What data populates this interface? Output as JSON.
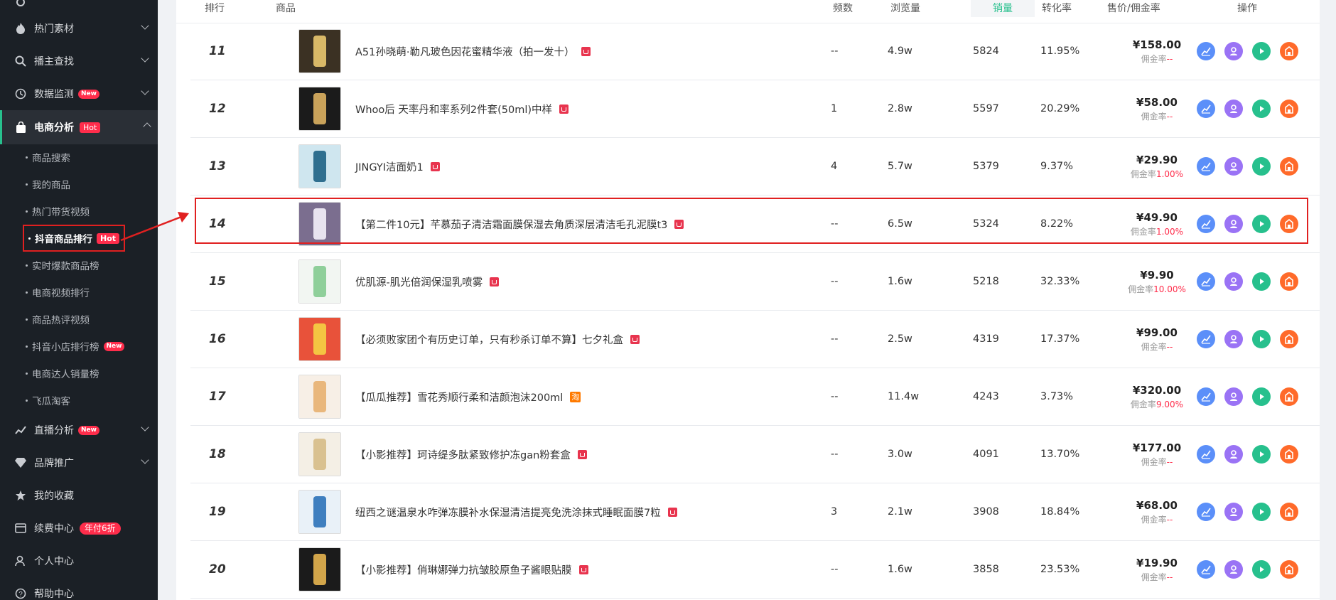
{
  "colors": {
    "accent": "#27c08d",
    "badge_red": "#ff2d4b",
    "highlight": "#e02020",
    "sidebar_bg": "#1b2026"
  },
  "sidebar": {
    "items": [
      {
        "label": "",
        "icon": "gear-icon",
        "chevron": true
      },
      {
        "label": "热门素材",
        "icon": "fire-icon",
        "chevron": true
      },
      {
        "label": "播主查找",
        "icon": "search-icon",
        "chevron": true
      },
      {
        "label": "数据监测",
        "icon": "monitor-icon",
        "chevron": true,
        "badge": "New"
      },
      {
        "label": "电商分析",
        "icon": "bag-icon",
        "chevron": true,
        "badge": "Hot",
        "active": true
      },
      {
        "label": "直播分析",
        "icon": "live-icon",
        "chevron": true,
        "badge": "New"
      },
      {
        "label": "品牌推广",
        "icon": "diamond-icon",
        "chevron": true
      },
      {
        "label": "我的收藏",
        "icon": "star-icon"
      },
      {
        "label": "续费中心",
        "icon": "card-icon",
        "badge": "年付6折"
      },
      {
        "label": "个人中心",
        "icon": "person-icon"
      },
      {
        "label": "帮助中心",
        "icon": "help-icon"
      }
    ],
    "sub_items": [
      {
        "label": "商品搜索"
      },
      {
        "label": "我的商品"
      },
      {
        "label": "热门带货视频"
      },
      {
        "label": "抖音商品排行",
        "badge": "Hot",
        "current": true
      },
      {
        "label": "实时爆款商品榜"
      },
      {
        "label": "电商视频排行"
      },
      {
        "label": "商品热评视频"
      },
      {
        "label": "抖音小店排行榜",
        "badge": "New"
      },
      {
        "label": "电商达人销量榜"
      },
      {
        "label": "飞瓜淘客"
      }
    ]
  },
  "table": {
    "headers": {
      "rank": "排行",
      "product": "商品",
      "freq": "频数",
      "views": "浏览量",
      "sales": "销量",
      "conv": "转化率",
      "price": "售价/佣金率",
      "ops": "操作"
    },
    "commission_label": "佣金率",
    "rows": [
      {
        "rank": "11",
        "name": "A51孙晓萌·勒凡玻色因花蜜精华液（拍一发十）",
        "tag": "shop",
        "freq": "--",
        "views": "4.9w",
        "sales": "5824",
        "conv": "11.95%",
        "price": "¥158.00",
        "rate": "--"
      },
      {
        "rank": "12",
        "name": "Whoo后 天率丹和率系列2件套(50ml)中样",
        "tag": "shop",
        "freq": "1",
        "views": "2.8w",
        "sales": "5597",
        "conv": "20.29%",
        "price": "¥58.00",
        "rate": "--"
      },
      {
        "rank": "13",
        "name": "JINGYI洁面奶1",
        "tag": "shop",
        "freq": "4",
        "views": "5.7w",
        "sales": "5379",
        "conv": "9.37%",
        "price": "¥29.90",
        "rate": "1.00%"
      },
      {
        "rank": "14",
        "name": "【第二件10元】芊慕茄子清洁霜面膜保湿去角质深层清洁毛孔泥膜t3",
        "tag": "shop",
        "freq": "--",
        "views": "6.5w",
        "sales": "5324",
        "conv": "8.22%",
        "price": "¥49.90",
        "rate": "1.00%"
      },
      {
        "rank": "15",
        "name": "优肌源-肌光倍润保湿乳喷雾",
        "tag": "shop",
        "freq": "--",
        "views": "1.6w",
        "sales": "5218",
        "conv": "32.33%",
        "price": "¥9.90",
        "rate": "10.00%"
      },
      {
        "rank": "16",
        "name": "【必须败家团个有历史订单，只有秒杀订单不算】七夕礼盒",
        "tag": "shop",
        "freq": "--",
        "views": "2.5w",
        "sales": "4319",
        "conv": "17.37%",
        "price": "¥99.00",
        "rate": "--"
      },
      {
        "rank": "17",
        "name": "【瓜瓜推荐】雪花秀顺行柔和洁颜泡沫200ml",
        "tag": "taobao",
        "tag_text": "淘",
        "freq": "--",
        "views": "11.4w",
        "sales": "4243",
        "conv": "3.73%",
        "price": "¥320.00",
        "rate": "9.00%"
      },
      {
        "rank": "18",
        "name": "【小影推荐】珂诗缇多肽紧致修护冻gan粉套盒",
        "tag": "shop",
        "freq": "--",
        "views": "3.0w",
        "sales": "4091",
        "conv": "13.70%",
        "price": "¥177.00",
        "rate": "--"
      },
      {
        "rank": "19",
        "name": "纽西之谜温泉水咋弹冻膜补水保湿清洁提亮免洗涂抹式睡眠面膜7粒",
        "tag": "shop",
        "freq": "3",
        "views": "2.1w",
        "sales": "3908",
        "conv": "18.84%",
        "price": "¥68.00",
        "rate": "--"
      },
      {
        "rank": "20",
        "name": "【小影推荐】俏琳娜弹力抗皱胶原鱼子酱眼贴膜",
        "tag": "shop",
        "freq": "--",
        "views": "1.6w",
        "sales": "3858",
        "conv": "23.53%",
        "price": "¥19.90",
        "rate": "--"
      }
    ]
  }
}
